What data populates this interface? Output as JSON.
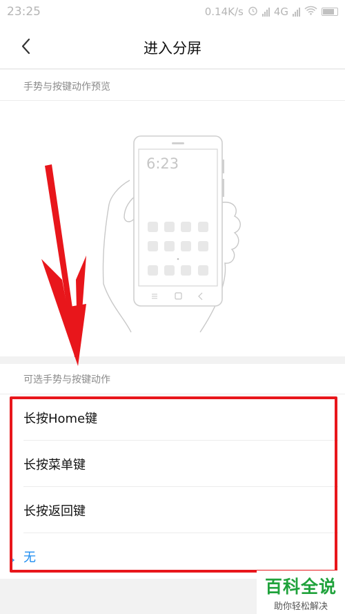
{
  "status_bar": {
    "time": "23:25",
    "net_speed": "0.14K/s",
    "network": "4G",
    "icons": [
      "alarm-icon",
      "signal-icon",
      "wifi-icon",
      "battery-icon"
    ]
  },
  "header": {
    "title": "进入分屏",
    "back_icon": "chevron-left-icon"
  },
  "preview": {
    "section_title": "手势与按键动作预览",
    "phone_time": "6:23"
  },
  "options": {
    "section_title": "可选手势与按键动作",
    "items": [
      {
        "label": "长按Home键",
        "selected": false
      },
      {
        "label": "长按菜单键",
        "selected": false
      },
      {
        "label": "长按返回键",
        "selected": false
      },
      {
        "label": "无",
        "selected": true
      }
    ]
  },
  "colors": {
    "accent": "#1c8cf0",
    "annotation_red": "#e8161b",
    "watermark_green": "#1fa23b"
  },
  "watermark": {
    "title": "百科全说",
    "subtitle": "助你轻松解决"
  }
}
